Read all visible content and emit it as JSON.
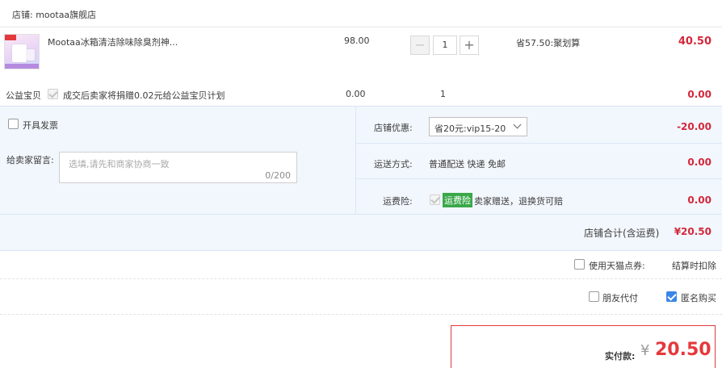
{
  "shop": {
    "label": "店铺: mootaa旗舰店"
  },
  "item": {
    "thumb_text": "Mootaa",
    "title": "Mootaa冰箱清洁除味除臭剂神...",
    "price": "98.00",
    "quantity": "1",
    "minus": "−",
    "plus": "+",
    "discount": "省57.50:聚划算",
    "subtotal": "40.50"
  },
  "charity": {
    "label": "公益宝贝",
    "desc": "成交后卖家将捐赠0.02元给公益宝贝计划",
    "price": "0.00",
    "qty": "1",
    "subtotal": "0.00"
  },
  "invoice": {
    "label": "开具发票"
  },
  "message": {
    "label": "给卖家留言:",
    "placeholder": "选填,请先和商家协商一致",
    "counter": "0/200"
  },
  "shop_discount": {
    "label": "店铺优惠:",
    "selected": "省20元:vip15-20",
    "amount": "-20.00"
  },
  "shipping": {
    "label": "运送方式:",
    "value": "普通配送 快递 免邮",
    "amount": "0.00"
  },
  "insurance": {
    "label": "运费险:",
    "badge": "运费险",
    "desc": "卖家赠送，退换货可赔",
    "amount": "0.00"
  },
  "shop_total": {
    "label": "店铺合计(含运费)",
    "amount": "¥20.50"
  },
  "points": {
    "label": "使用天猫点券:",
    "note": "结算时扣除"
  },
  "options": {
    "friend_pay": "朋友代付",
    "anonymous": "匿名购买"
  },
  "pay": {
    "label": "实付款:",
    "currency": "¥",
    "amount": "20.50"
  },
  "colors": {
    "accent_red": "#d4283b",
    "panel_blue": "#f2f7fd",
    "checkbox_blue": "#3a86e8",
    "badge_green": "#3aa84a"
  }
}
